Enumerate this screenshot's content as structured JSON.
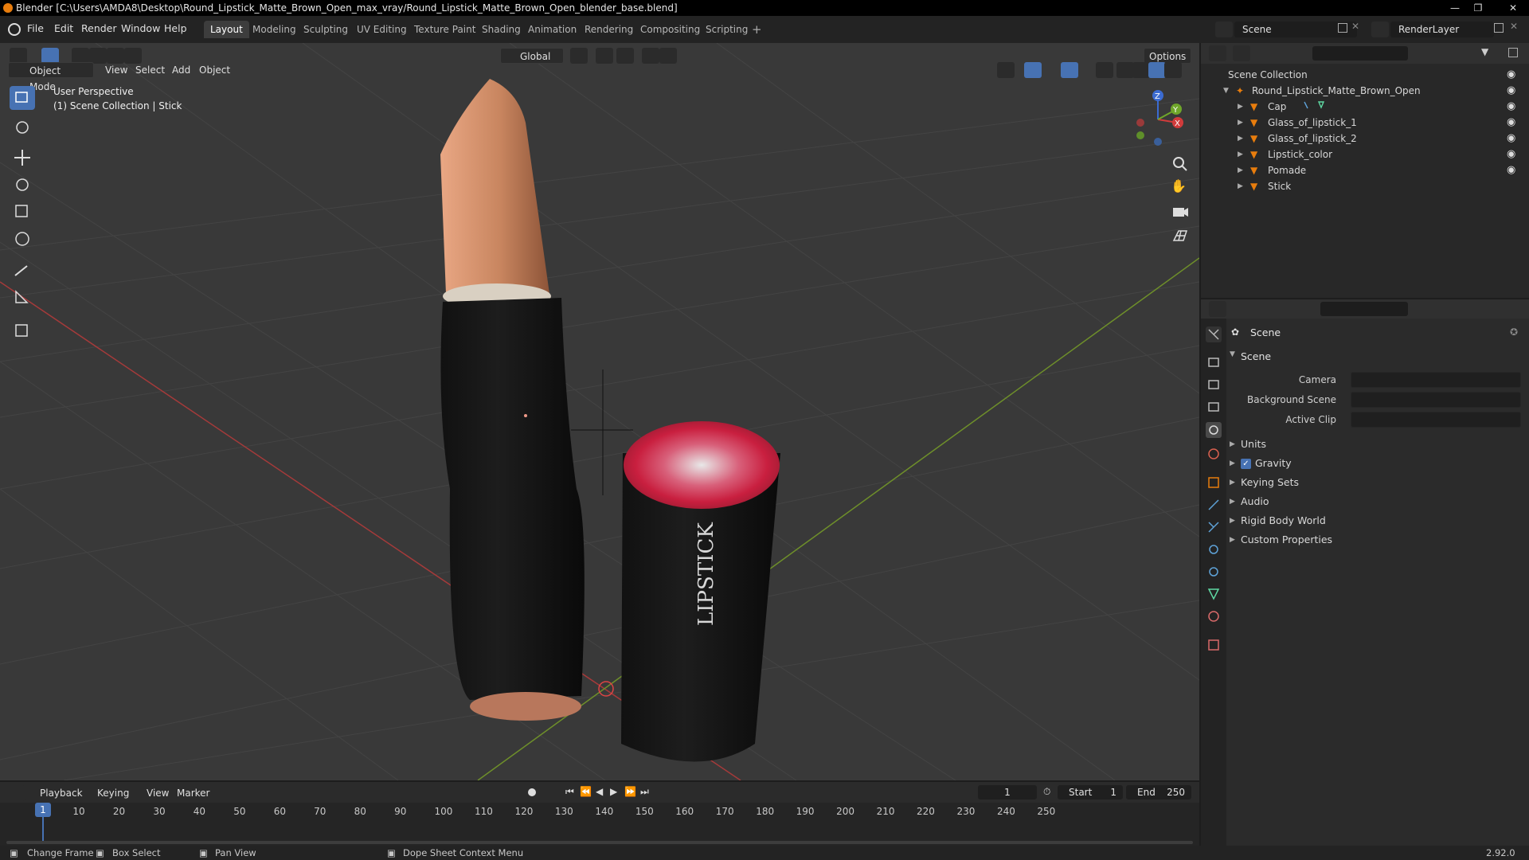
{
  "window": {
    "title": "Blender [C:\\Users\\AMDA8\\Desktop\\Round_Lipstick_Matte_Brown_Open_max_vray/Round_Lipstick_Matte_Brown_Open_blender_base.blend]"
  },
  "menus": [
    "File",
    "Edit",
    "Render",
    "Window",
    "Help"
  ],
  "workspaces": [
    "Layout",
    "Modeling",
    "Sculpting",
    "UV Editing",
    "Texture Paint",
    "Shading",
    "Animation",
    "Rendering",
    "Compositing",
    "Scripting"
  ],
  "active_workspace": "Layout",
  "topright": {
    "scene": "Scene",
    "render_layer": "RenderLayer"
  },
  "viewport": {
    "transform_orientation": "Global",
    "options_label": "Options",
    "mode": "Object Mode",
    "header_menus": [
      "View",
      "Select",
      "Add",
      "Object"
    ],
    "overlay_line1": "User Perspective",
    "overlay_line2": "(1) Scene Collection | Stick",
    "cap_text": "LIPSTICK"
  },
  "outliner": {
    "root": "Scene Collection",
    "collection": "Round_Lipstick_Matte_Brown_Open",
    "objects": [
      "Cap",
      "Glass_of_lipstick_1",
      "Glass_of_lipstick_2",
      "Lipstick_color",
      "Pomade",
      "Stick"
    ]
  },
  "properties": {
    "context": "Scene",
    "section": "Scene",
    "fields": {
      "camera": "Camera",
      "background_scene": "Background Scene",
      "active_clip": "Active Clip"
    },
    "panels": [
      "Units",
      "Gravity",
      "Keying Sets",
      "Audio",
      "Rigid Body World",
      "Custom Properties"
    ],
    "gravity_checked": true
  },
  "timeline": {
    "menus": [
      "Playback",
      "Keying",
      "View",
      "Marker"
    ],
    "current_frame": "1",
    "start_label": "Start",
    "start": "1",
    "end_label": "End",
    "end": "250",
    "ticks": [
      "1",
      "10",
      "20",
      "30",
      "40",
      "50",
      "60",
      "70",
      "80",
      "90",
      "100",
      "110",
      "120",
      "130",
      "140",
      "150",
      "160",
      "170",
      "180",
      "190",
      "200",
      "210",
      "220",
      "230",
      "240",
      "250"
    ]
  },
  "statusbar": {
    "change_frame": "Change Frame",
    "box_select": "Box Select",
    "pan_view": "Pan View",
    "context_menu": "Dope Sheet Context Menu",
    "version": "2.92.0"
  },
  "colors": {
    "accent": "#4772b3",
    "axis_x": "#c33b3b",
    "axis_y": "#7faa2a",
    "object_orange": "#e87d0d"
  }
}
